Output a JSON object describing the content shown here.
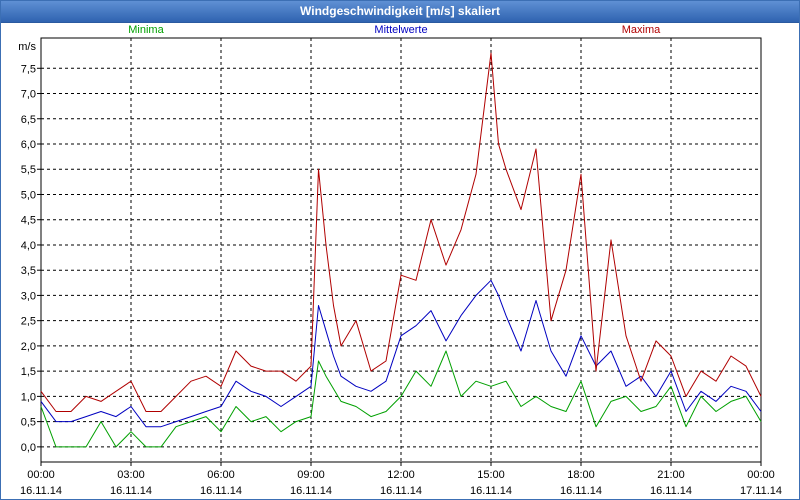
{
  "window": {
    "title": "Windgeschwindigkeit [m/s] skaliert"
  },
  "chart_data": {
    "type": "line",
    "title": "Windgeschwindigkeit [m/s] skaliert",
    "ylabel": "m/s",
    "ylim": [
      -0.3,
      8.1
    ],
    "yticks": [
      0.0,
      0.5,
      1.0,
      1.5,
      2.0,
      2.5,
      3.0,
      3.5,
      4.0,
      4.5,
      5.0,
      5.5,
      6.0,
      6.5,
      7.0,
      7.5
    ],
    "ytick_labels": [
      "0,0",
      "0,5",
      "1,0",
      "1,5",
      "2,0",
      "2,5",
      "3,0",
      "3,5",
      "4,0",
      "4,5",
      "5,0",
      "5,5",
      "6,0",
      "6,5",
      "7,0",
      "7,5"
    ],
    "xlim_hours": [
      0,
      24
    ],
    "xticks_hours": [
      0,
      3,
      6,
      9,
      12,
      15,
      18,
      21,
      24
    ],
    "xtick_time_labels": [
      "00:00",
      "03:00",
      "06:00",
      "09:00",
      "12:00",
      "15:00",
      "18:00",
      "21:00",
      "00:00"
    ],
    "xtick_date_labels": [
      "16.11.14",
      "16.11.14",
      "16.11.14",
      "16.11.14",
      "16.11.14",
      "16.11.14",
      "16.11.14",
      "16.11.14",
      "17.11.14"
    ],
    "grid": true,
    "series": [
      {
        "name": "Minima",
        "color": "#00a000",
        "x": [
          0,
          0.5,
          1,
          1.5,
          2,
          2.5,
          3,
          3.5,
          4,
          4.5,
          5,
          5.5,
          6,
          6.5,
          7,
          7.5,
          8,
          8.5,
          9,
          9.25,
          9.5,
          10,
          10.5,
          11,
          11.5,
          12,
          12.5,
          13,
          13.5,
          14,
          14.5,
          15,
          15.5,
          16,
          16.5,
          17,
          17.5,
          18,
          18.5,
          19,
          19.5,
          20,
          20.5,
          21,
          21.5,
          22,
          22.5,
          23,
          23.5,
          24
        ],
        "values": [
          0.8,
          0.0,
          0.0,
          0.0,
          0.5,
          0.0,
          0.3,
          0.0,
          0.0,
          0.4,
          0.5,
          0.6,
          0.3,
          0.8,
          0.5,
          0.6,
          0.3,
          0.5,
          0.6,
          1.7,
          1.4,
          0.9,
          0.8,
          0.6,
          0.7,
          1.0,
          1.5,
          1.2,
          1.9,
          1.0,
          1.3,
          1.2,
          1.3,
          0.8,
          1.0,
          0.8,
          0.7,
          1.3,
          0.4,
          0.9,
          1.0,
          0.7,
          0.8,
          1.2,
          0.4,
          1.0,
          0.7,
          0.9,
          1.0,
          0.5
        ]
      },
      {
        "name": "Mittelwerte",
        "color": "#0000c0",
        "x": [
          0,
          0.5,
          1,
          1.5,
          2,
          2.5,
          3,
          3.5,
          4,
          4.5,
          5,
          5.5,
          6,
          6.5,
          7,
          7.5,
          8,
          8.5,
          9,
          9.25,
          9.5,
          9.75,
          10,
          10.5,
          11,
          11.5,
          12,
          12.5,
          13,
          13.5,
          14,
          14.5,
          15,
          15.25,
          15.5,
          16,
          16.5,
          17,
          17.5,
          18,
          18.5,
          19,
          19.5,
          20,
          20.5,
          21,
          21.5,
          22,
          22.5,
          23,
          23.5,
          24
        ],
        "values": [
          0.9,
          0.5,
          0.5,
          0.6,
          0.7,
          0.6,
          0.8,
          0.4,
          0.4,
          0.5,
          0.6,
          0.7,
          0.8,
          1.3,
          1.1,
          1.0,
          0.8,
          1.0,
          1.2,
          2.8,
          2.3,
          1.8,
          1.4,
          1.2,
          1.1,
          1.3,
          2.2,
          2.4,
          2.7,
          2.1,
          2.6,
          3.0,
          3.3,
          3.0,
          2.6,
          1.9,
          2.9,
          1.9,
          1.4,
          2.2,
          1.6,
          1.9,
          1.2,
          1.4,
          1.0,
          1.5,
          0.7,
          1.1,
          0.9,
          1.2,
          1.1,
          0.7
        ]
      },
      {
        "name": "Maxima",
        "color": "#b00000",
        "x": [
          0,
          0.5,
          1,
          1.5,
          2,
          2.5,
          3,
          3.5,
          4,
          4.5,
          5,
          5.5,
          6,
          6.5,
          7,
          7.5,
          8,
          8.5,
          9,
          9.25,
          9.5,
          9.75,
          10,
          10.5,
          11,
          11.5,
          12,
          12.5,
          13,
          13.5,
          14,
          14.5,
          15,
          15.25,
          15.5,
          16,
          16.5,
          17,
          17.5,
          18,
          18.5,
          19,
          19.5,
          20,
          20.5,
          21,
          21.5,
          22,
          22.5,
          23,
          23.5,
          24
        ],
        "values": [
          1.1,
          0.7,
          0.7,
          1.0,
          0.9,
          1.1,
          1.3,
          0.7,
          0.7,
          1.0,
          1.3,
          1.4,
          1.2,
          1.9,
          1.6,
          1.5,
          1.5,
          1.3,
          1.6,
          5.5,
          4.0,
          2.8,
          2.0,
          2.5,
          1.5,
          1.7,
          3.4,
          3.3,
          4.5,
          3.6,
          4.3,
          5.4,
          7.8,
          6.0,
          5.5,
          4.7,
          5.9,
          2.5,
          3.5,
          5.4,
          1.5,
          4.1,
          2.2,
          1.3,
          2.1,
          1.8,
          1.0,
          1.5,
          1.3,
          1.8,
          1.6,
          1.0
        ]
      }
    ]
  }
}
